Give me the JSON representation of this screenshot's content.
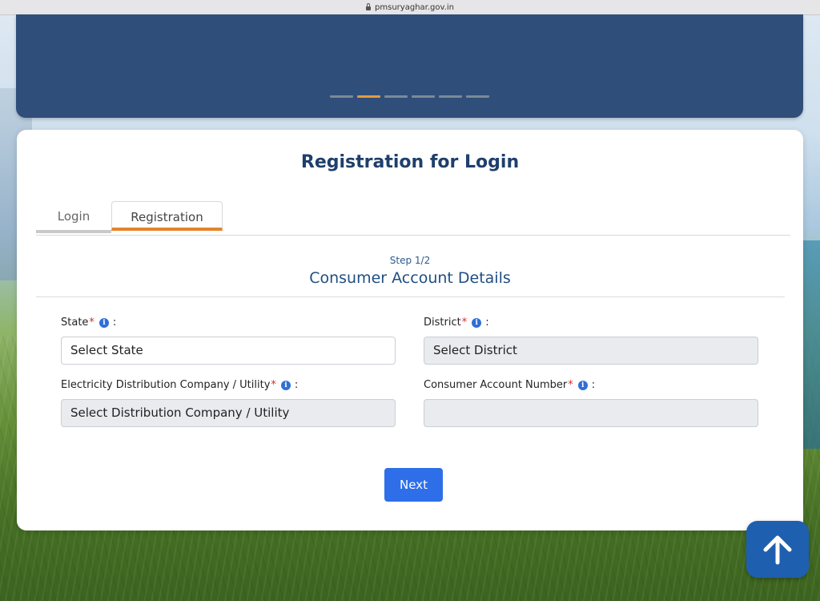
{
  "browser": {
    "url": "pmsuryaghar.gov.in"
  },
  "carousel": {
    "slide_count": 6,
    "active_index": 1
  },
  "form": {
    "title": "Registration for Login",
    "tabs": [
      {
        "label": "Login",
        "active": false
      },
      {
        "label": "Registration",
        "active": true
      }
    ],
    "step": "Step 1/2",
    "section_title": "Consumer Account Details",
    "fields": {
      "state": {
        "label": "State",
        "required": "*",
        "info": "i",
        "colon": ":",
        "value": "Select State"
      },
      "district": {
        "label": "District",
        "required": "*",
        "info": "i",
        "colon": ":",
        "value": "Select District"
      },
      "utility": {
        "label": "Electricity Distribution Company / Utility",
        "required": "*",
        "info": "i",
        "colon": ":",
        "value": "Select Distribution Company / Utility"
      },
      "consumer_number": {
        "label": "Consumer Account Number",
        "required": "*",
        "info": "i",
        "colon": ":",
        "value": ""
      }
    },
    "next_label": "Next"
  },
  "colors": {
    "primary": "#2e6fe9",
    "title": "#1f3f6b",
    "accent": "#e3832b",
    "banner": "#2f4e79",
    "required": "#d72b2b"
  },
  "icons": {
    "scroll_top": "arrow-up-icon",
    "info": "info-icon",
    "lock": "lock-icon"
  }
}
